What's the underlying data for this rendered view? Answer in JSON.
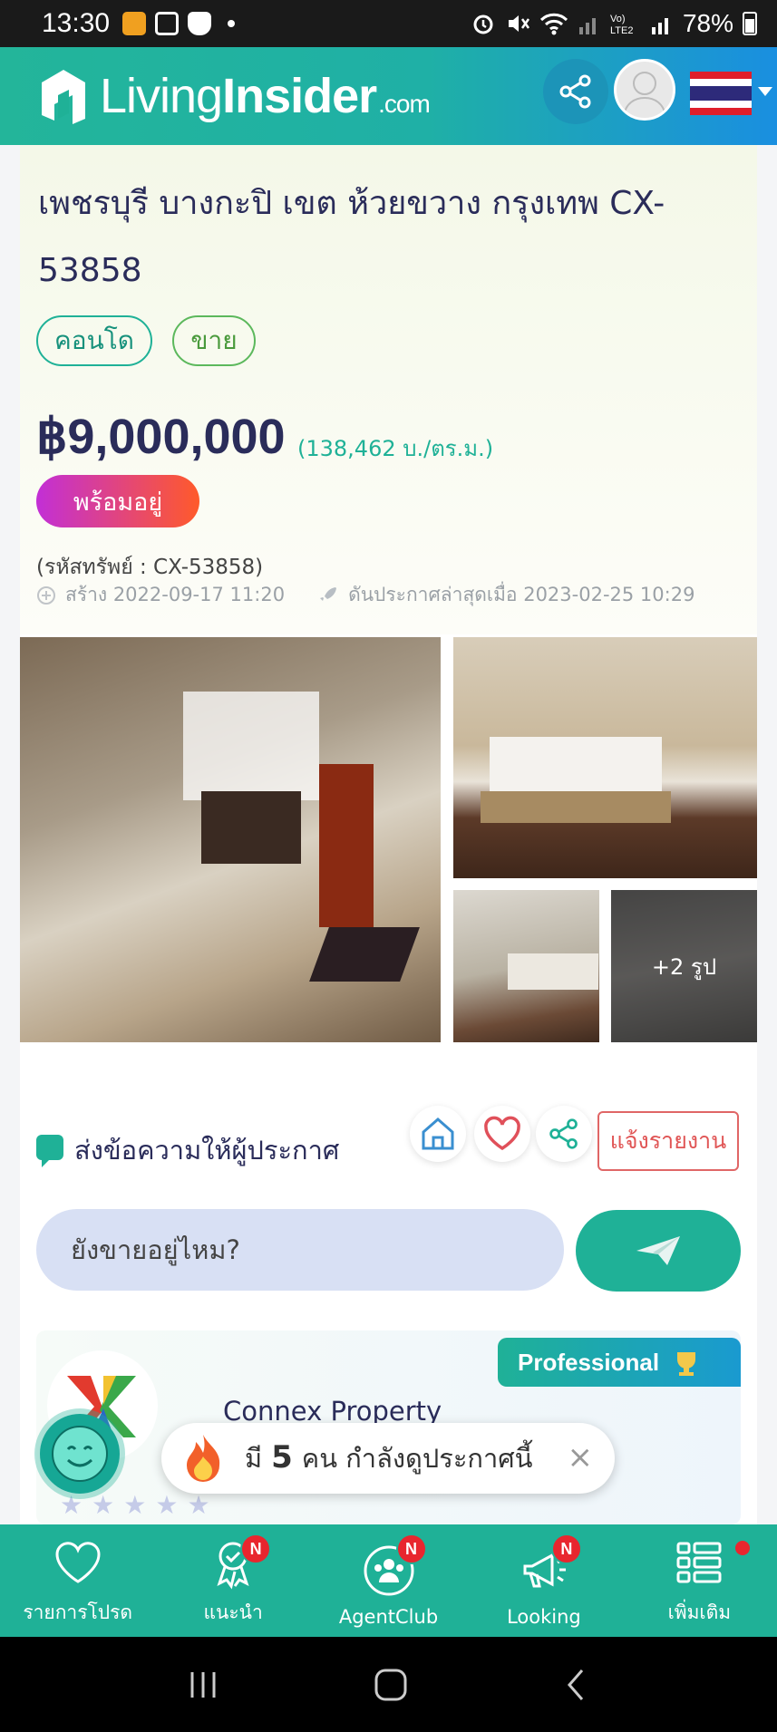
{
  "status_bar": {
    "time": "13:30",
    "battery": "78%",
    "icons": [
      "alarm-icon",
      "mute-icon",
      "wifi-icon",
      "signal-icon",
      "volte-icon",
      "battery-icon"
    ]
  },
  "header": {
    "brand_light": "Living",
    "brand_bold": "Insider",
    "brand_suffix": ".com",
    "colors": {
      "start": "#23b59a",
      "end": "#1a8fe0"
    }
  },
  "listing": {
    "title": "เพชรบุรี บางกะปิ เขต ห้วยขวาง กรุงเทพ CX-53858",
    "tags": [
      "คอนโด",
      "ขาย"
    ],
    "price": "฿9,000,000",
    "price_per_area": "(138,462 บ./ตร.ม.)",
    "ready_badge": "พร้อมอยู่",
    "property_code": "(รหัสทรัพย์ : CX-53858)",
    "created": "สร้าง 2022-09-17 11:20",
    "boosted": "ดันประกาศล่าสุดเมื่อ 2023-02-25 10:29"
  },
  "photos": {
    "more_label": "+2 รูป"
  },
  "actions": {
    "message_label": "ส่งข้อความให้ผู้ประกาศ",
    "report_label": "แจ้งรายงาน",
    "message_value": "ยังขายอยู่ไหม?"
  },
  "agent": {
    "badge": "Professional",
    "name": "Connex Property"
  },
  "viewers": {
    "prefix": "มี",
    "count": "5",
    "suffix": "คน กำลังดูประกาศนี้",
    "close": "×"
  },
  "bottom_nav": {
    "items": [
      {
        "label": "รายการโปรด",
        "icon": "heart-icon",
        "badge": ""
      },
      {
        "label": "แนะนำ",
        "icon": "award-icon",
        "badge": "N"
      },
      {
        "label": "AgentClub",
        "icon": "group-icon",
        "badge": "N"
      },
      {
        "label": "Looking",
        "icon": "megaphone-icon",
        "badge": "N"
      },
      {
        "label": "เพิ่มเติม",
        "icon": "menu-list-icon",
        "badge": ""
      }
    ]
  },
  "accent": "#1fb197"
}
